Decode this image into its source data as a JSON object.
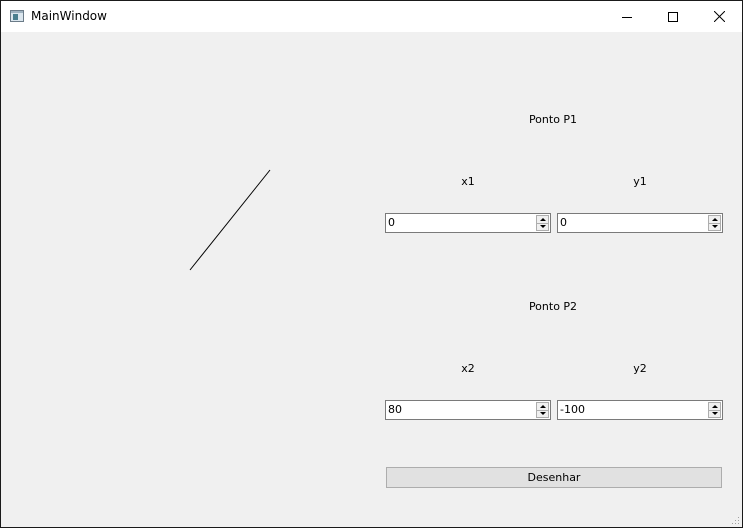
{
  "window": {
    "title": "MainWindow"
  },
  "p1": {
    "heading": "Ponto P1",
    "x_label": "x1",
    "y_label": "y1",
    "x_value": "0",
    "y_value": "0"
  },
  "p2": {
    "heading": "Ponto P2",
    "x_label": "x2",
    "y_label": "y2",
    "x_value": "80",
    "y_value": "-100"
  },
  "draw_button": {
    "label": "Desenhar"
  },
  "icons": {
    "minimize": "minimize-icon",
    "maximize": "maximize-icon",
    "close": "close-icon",
    "app": "app-window-icon"
  }
}
